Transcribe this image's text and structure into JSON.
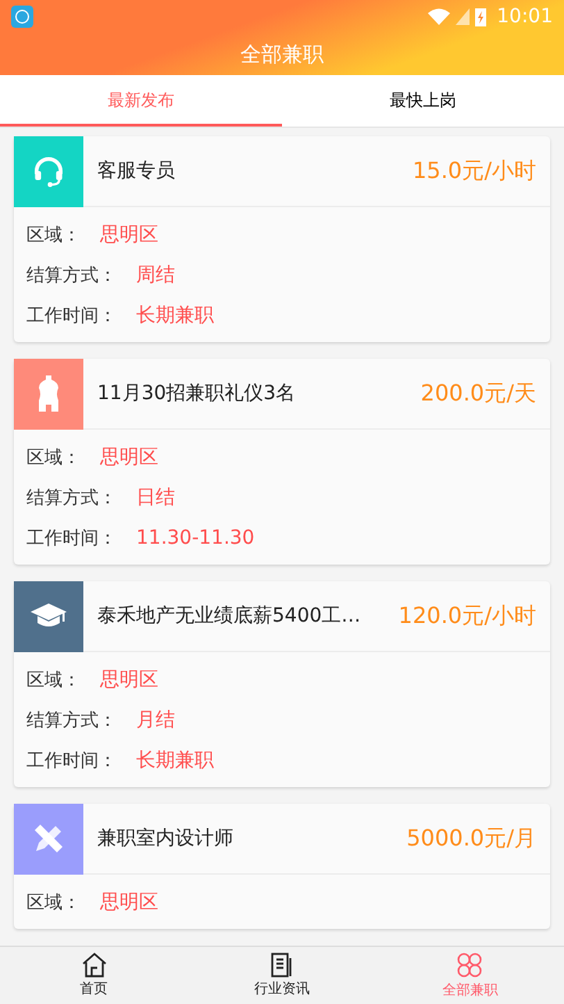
{
  "status_bar": {
    "time": "10:01"
  },
  "header": {
    "title": "全部兼职"
  },
  "tabs": [
    {
      "label": "最新发布",
      "selected": true
    },
    {
      "label": "最快上岗",
      "selected": false
    }
  ],
  "jobs": [
    {
      "title": "客服专员",
      "pay": "15.0元/小时",
      "color": "#14d5c4",
      "fields": [
        {
          "label": "区域：",
          "value": "思明区"
        },
        {
          "label": "结算方式：",
          "value": "周结"
        },
        {
          "label": "工作时间：",
          "value": "长期兼职"
        }
      ]
    },
    {
      "title": "11月30招兼职礼仪3名",
      "pay": "200.0元/天",
      "color": "#fe8a7a",
      "fields": [
        {
          "label": "区域：",
          "value": "思明区"
        },
        {
          "label": "结算方式：",
          "value": "日结"
        },
        {
          "label": "工作时间：",
          "value": "11.30-11.30"
        }
      ]
    },
    {
      "title": "泰禾地产无业绩底薪5400工…",
      "pay": "120.0元/小时",
      "color": "#50708c",
      "fields": [
        {
          "label": "区域：",
          "value": "思明区"
        },
        {
          "label": "结算方式：",
          "value": "月结"
        },
        {
          "label": "工作时间：",
          "value": "长期兼职"
        }
      ]
    },
    {
      "title": "兼职室内设计师",
      "pay": "5000.0元/月",
      "color": "#9a9dfc",
      "fields": [
        {
          "label": "区域：",
          "value": "思明区"
        }
      ]
    }
  ],
  "bottom_nav": [
    {
      "label": "首页",
      "selected": false
    },
    {
      "label": "行业资讯",
      "selected": false
    },
    {
      "label": "全部兼职",
      "selected": true
    }
  ]
}
